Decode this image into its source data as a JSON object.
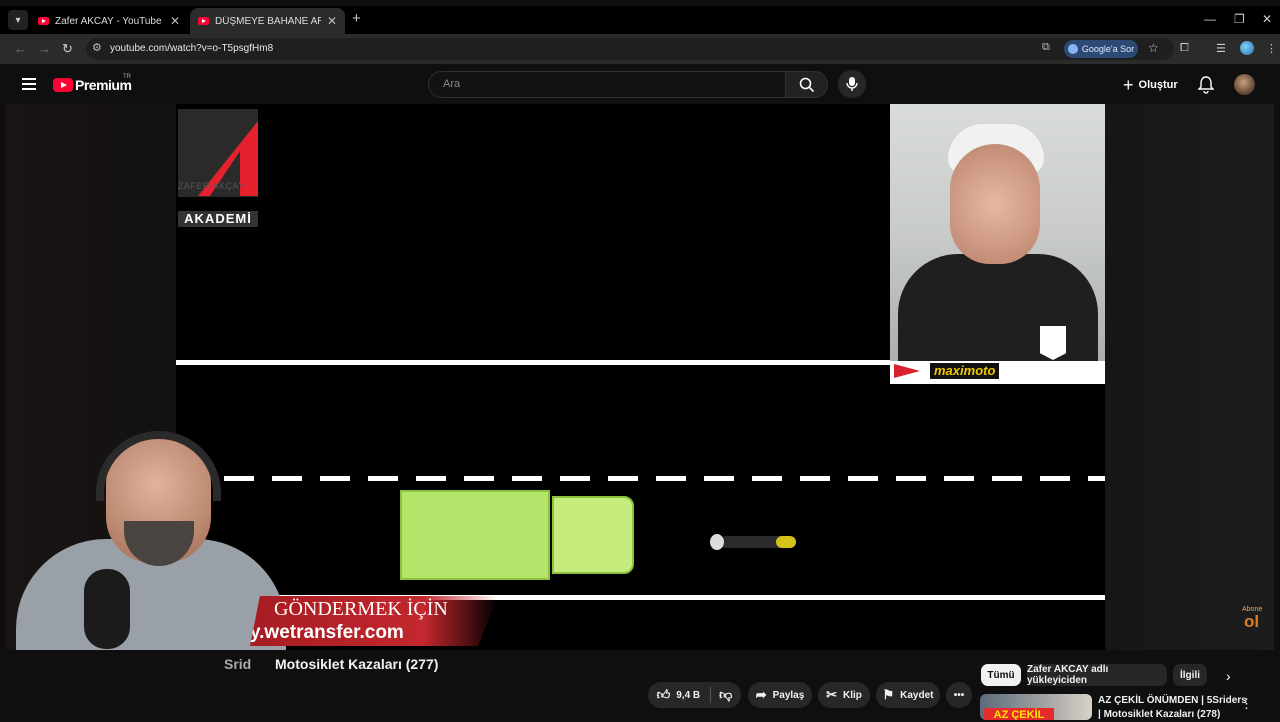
{
  "browser": {
    "tabs": [
      {
        "title": "Zafer AKCAY - YouTube"
      },
      {
        "title": "DÜŞMEYE BAHANE ARAMAK |"
      }
    ],
    "url": "youtube.com/watch?v=o-T5psgfHm8",
    "ask_google_label": "Google'a Sor"
  },
  "header": {
    "brand": "Premium",
    "country_code": "TR",
    "search_placeholder": "Ara",
    "create_label": "Oluştur"
  },
  "video": {
    "logo_name": "ZAFER AKÇAY",
    "logo_academy": "AKADEMİ",
    "sponsor": "maximoto",
    "banner_line1": "GÖNDERMEK İÇİN",
    "banner_line2": "y.wetransfer.com",
    "corner_badge_small": "Abone",
    "corner_badge_big": "ol",
    "title_prefix": "Srid",
    "title": "Motosiklet Kazaları (277)"
  },
  "actions": {
    "likes": "9,4 B",
    "share": "Paylaş",
    "clip": "Klip",
    "save": "Kaydet"
  },
  "chips": [
    "Tümü",
    "Zafer AKCAY adlı yükleyiciden",
    "İlgili"
  ],
  "recommendation": {
    "title": "AZ ÇEKİL ÖNÜMDEN | 5Sriders | Motosiklet Kazaları (278)",
    "thumb_text": "AZ ÇEKİL"
  },
  "colors": {
    "accent": "#ff0033",
    "truck": "#b5e46a",
    "banner": "#c3282e"
  }
}
